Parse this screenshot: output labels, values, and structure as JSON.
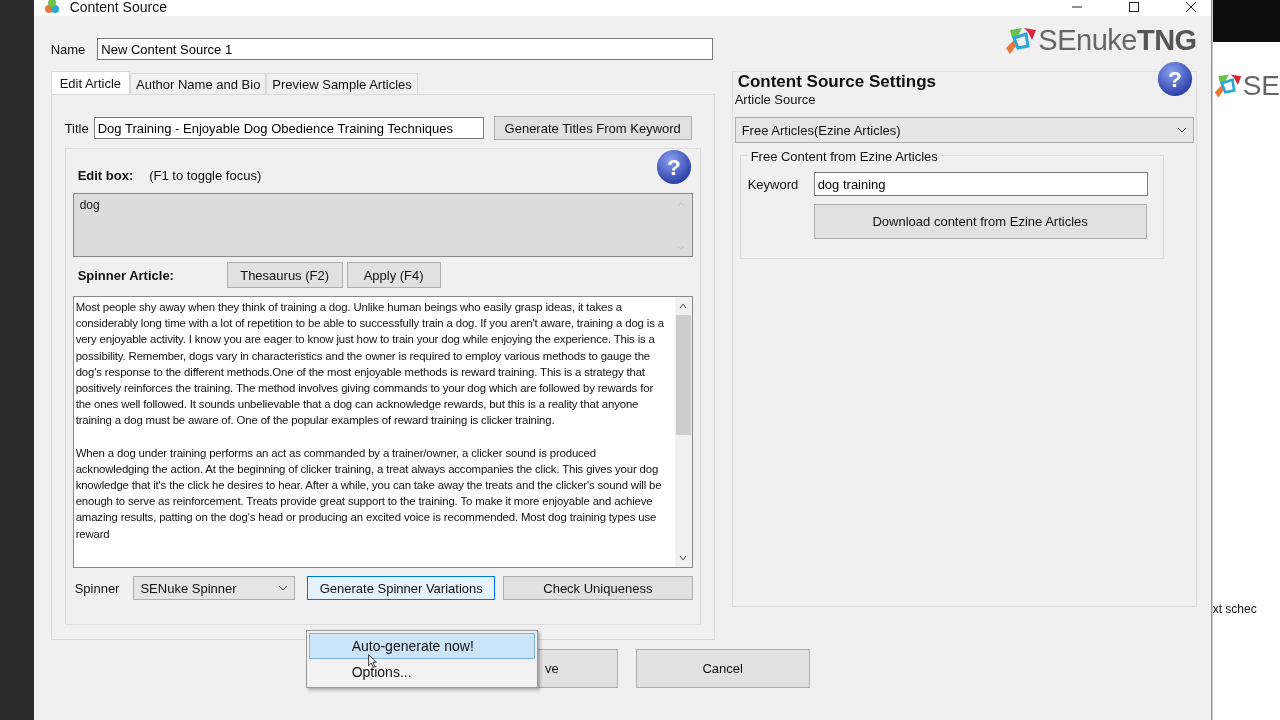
{
  "window": {
    "title": "Content Source"
  },
  "name_field": {
    "label": "Name",
    "value": "New Content Source 1"
  },
  "logo": {
    "text": "SEnuke",
    "bold_text": "TNG"
  },
  "tabs": [
    {
      "label": "Edit Article",
      "selected": true
    },
    {
      "label": "Author Name and Bio",
      "selected": false
    },
    {
      "label": "Preview Sample Articles",
      "selected": false
    }
  ],
  "title_field": {
    "label": "Title",
    "value": "Dog Training - Enjoyable Dog Obedience Training Techniques",
    "button": "Generate Titles From Keyword"
  },
  "edit_box": {
    "label": "Edit box:",
    "hint": "(F1 to toggle focus)",
    "value": "dog",
    "help_icon": "?"
  },
  "spinner_article": {
    "label": "Spinner Article:",
    "buttons": [
      "Thesaurus (F2)",
      "Apply (F4)"
    ],
    "paragraphs": [
      "Most people shy away when they think of training a dog. Unlike human beings who easily grasp ideas, it takes a considerably long time with a lot of repetition to be able to successfully train a dog. If you aren't aware, training a dog is a very enjoyable activity. I know you are eager to know just how to train your dog while enjoying the experience. This is a possibility. Remember, dogs vary in characteristics and the owner is required to employ various methods to gauge the dog's response to the different methods.One of the most enjoyable methods is reward training. This is a strategy that positively reinforces the training. The method involves giving commands to your dog which are followed by rewards for the ones well followed. It sounds unbelievable that a dog can acknowledge rewards, but this is a reality that anyone training a dog must be aware of. One of the popular examples of reward training is clicker training.",
      "When a dog under training performs an act as commanded by a trainer/owner, a clicker sound is produced acknowledging the action. At the beginning of clicker training, a treat always accompanies the click. This gives your dog knowledge that it's the click he desires to hear. After a while, you can take away the treats and the clicker's sound will be enough to serve as reinforcement. Treats provide great support to the training. To make it more enjoyable and achieve amazing results, patting on the dog's head or producing an excited voice is recommended. Most dog training types use reward"
    ]
  },
  "spinner": {
    "label": "Spinner",
    "value": "SENuke Spinner",
    "generate_button": "Generate Spinner Variations",
    "check_button": "Check Uniqueness"
  },
  "menu": {
    "items": [
      {
        "label": "Auto-generate now!",
        "selected": true
      },
      {
        "label": "Options...",
        "selected": false
      }
    ]
  },
  "settings": {
    "heading": "Content Source Settings",
    "help_icon": "?",
    "source_label": "Article Source",
    "source_value": "Free Articles(Ezine Articles)",
    "group_title": "Free Content from Ezine Articles",
    "keyword_label": "Keyword",
    "keyword_value": "dog training",
    "download_button": "Download content from Ezine Articles"
  },
  "footer": {
    "buttons": [
      "ve",
      "Cancel"
    ]
  },
  "background_window": {
    "logo_text": "SE",
    "text": "xt schec"
  }
}
